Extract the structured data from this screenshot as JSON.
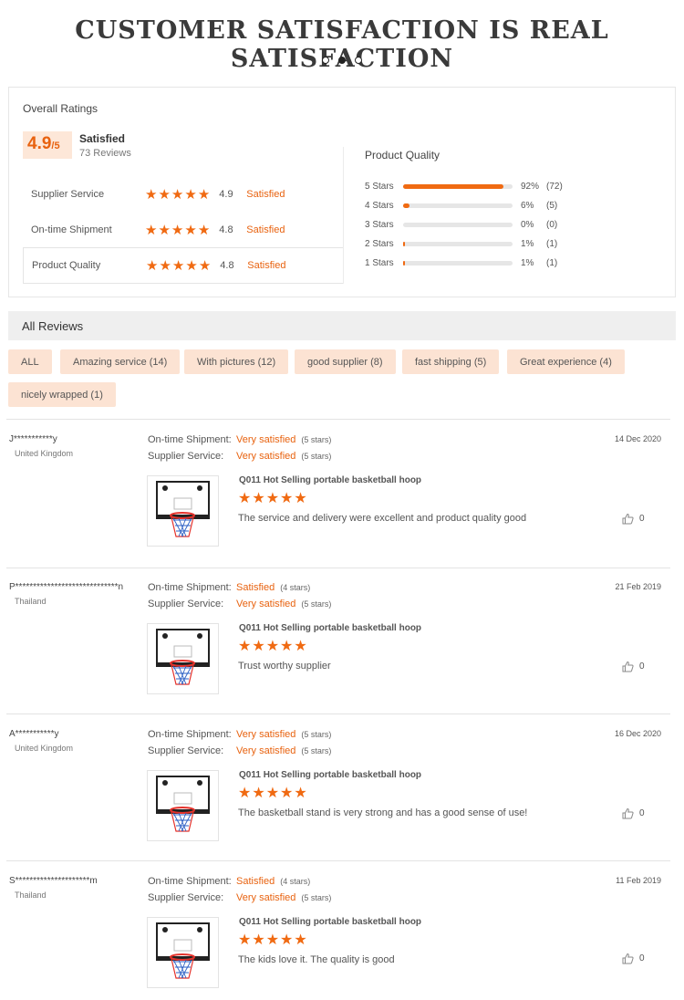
{
  "banner": {
    "title": "CUSTOMER SATISFACTION IS REAL SATISFACTION"
  },
  "carousel": {
    "dots": 3,
    "active": 2
  },
  "overall": {
    "title": "Overall Ratings",
    "score": "4.9",
    "score_denominator": "/5",
    "label": "Satisfied",
    "count": "73 Reviews",
    "metrics": [
      {
        "name": "Supplier Service",
        "score": "4.9",
        "status": "Satisfied"
      },
      {
        "name": "On-time Shipment",
        "score": "4.8",
        "status": "Satisfied"
      },
      {
        "name": "Product Quality",
        "score": "4.8",
        "status": "Satisfied"
      }
    ]
  },
  "product_quality": {
    "title": "Product Quality",
    "rows": [
      {
        "label": "5 Stars",
        "percent": 92,
        "pct_text": "92%",
        "count": "(72)"
      },
      {
        "label": "4 Stars",
        "percent": 6,
        "pct_text": "6%",
        "count": "(5)"
      },
      {
        "label": "3 Stars",
        "percent": 0,
        "pct_text": "0%",
        "count": "(0)"
      },
      {
        "label": "2 Stars",
        "percent": 1,
        "pct_text": "1%",
        "count": "(1)"
      },
      {
        "label": "1 Stars",
        "percent": 1,
        "pct_text": "1%",
        "count": "(1)"
      }
    ]
  },
  "all_reviews": {
    "title": "All Reviews",
    "tags": [
      "ALL",
      "Amazing service (14)",
      "With pictures (12)",
      "good supplier (8)",
      "fast shipping (5)",
      "Great experience (4)",
      "nicely wrapped (1)"
    ]
  },
  "reviews": [
    {
      "user": "J***********y",
      "country": "United Kingdom",
      "date": "14 Dec 2020",
      "shipment_label": "On-time Shipment:",
      "shipment_value": "Very satisfied",
      "shipment_stars": "(5 stars)",
      "service_label": "Supplier Service:",
      "service_value": "Very satisfied",
      "service_stars": "(5 stars)",
      "product": "Q011 Hot Selling portable basketball hoop",
      "text": "The service and delivery were excellent and product quality good",
      "likes": "0"
    },
    {
      "user": "P*****************************n",
      "country": "Thailand",
      "date": "21 Feb 2019",
      "shipment_label": "On-time Shipment:",
      "shipment_value": "Satisfied",
      "shipment_stars": "(4 stars)",
      "service_label": "Supplier Service:",
      "service_value": "Very satisfied",
      "service_stars": "(5 stars)",
      "product": "Q011 Hot Selling portable basketball hoop",
      "text": "Trust worthy supplier",
      "likes": "0"
    },
    {
      "user": "A***********y",
      "country": "United Kingdom",
      "date": "16 Dec 2020",
      "shipment_label": "On-time Shipment:",
      "shipment_value": "Very satisfied",
      "shipment_stars": "(5 stars)",
      "service_label": "Supplier Service:",
      "service_value": "Very satisfied",
      "service_stars": "(5 stars)",
      "product": "Q011 Hot Selling portable basketball hoop",
      "text": "The basketball stand is very strong and has a good sense of use!",
      "likes": "0"
    },
    {
      "user": "S*********************m",
      "country": "Thailand",
      "date": "11 Feb 2019",
      "shipment_label": "On-time Shipment:",
      "shipment_value": "Satisfied",
      "shipment_stars": "(4 stars)",
      "service_label": "Supplier Service:",
      "service_value": "Very satisfied",
      "service_stars": "(5 stars)",
      "product": "Q011 Hot Selling portable basketball hoop",
      "text": "The kids love it. The quality is good",
      "likes": "0"
    }
  ]
}
